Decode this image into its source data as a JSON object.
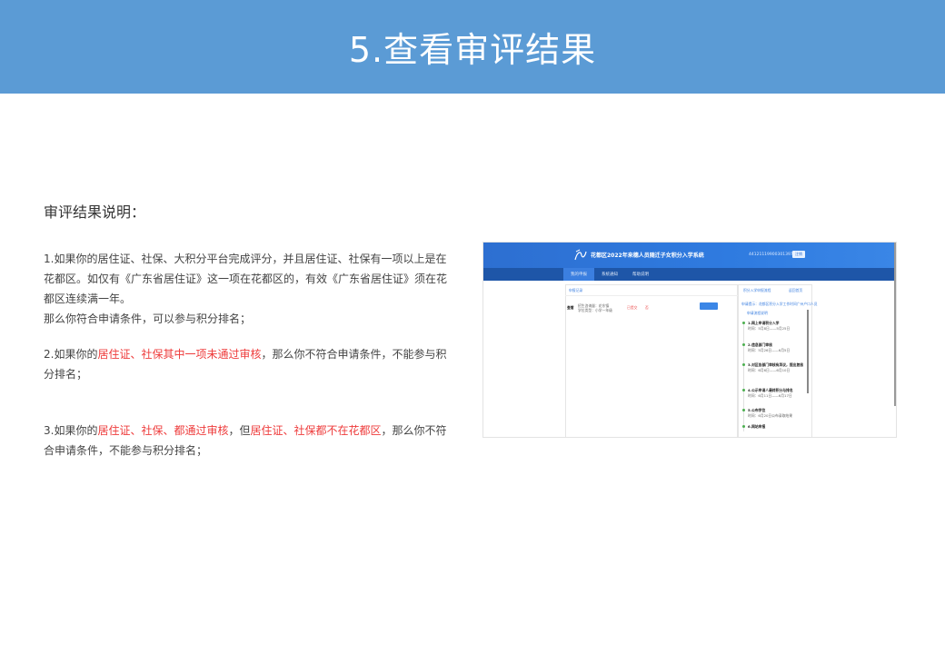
{
  "banner": {
    "title": "5.查看审评结果"
  },
  "section": {
    "title": "审评结果说明："
  },
  "paragraphs": {
    "p1": "1.如果你的居住证、社保、大积分平台完成评分，并且居住证、社保有一项以上是在花都区。如仅有《广东省居住证》这一项在花都区的，有效《广东省居住证》须在花都区连续满一年。",
    "p1_line2": "那么你符合申请条件，可以参与积分排名；",
    "p2_a": "2.如果你的",
    "p2_red": "居住证、社保其中一项未通过审核",
    "p2_b": "，那么你不符合申请条件，不能参与积分排名；",
    "p3_a": "3.如果你的",
    "p3_red1": "居住证、社保、都通过审核",
    "p3_b": "，但",
    "p3_red2": "居住证、社保都不在花都区",
    "p3_c": "，那么你不符合申请条件，不能参与积分排名；"
  },
  "screenshot": {
    "title": "花都区2022年来穗人员随迁子女积分入学系统",
    "user": "441211199003013977",
    "logout": "注销",
    "nav": [
      "我的申报",
      "系统通知",
      "帮助说明"
    ],
    "left_header": "申报记录",
    "row_name": "查看",
    "row_info1": "招生咨询量：花东镇",
    "row_info2": "学位类型：小学一年级",
    "row_status1": "已提交",
    "row_status2": "否",
    "right_header1": "积分入学申报流程",
    "right_header2": "返回首页",
    "right_note": "申请提示：花都区积分入学工作时间广州户口人员",
    "right_link": "申请流程说明",
    "steps": [
      {
        "title": "1.网上申请积分入学",
        "desc": "时间：5月8日——5月25日"
      },
      {
        "title": "2.信息部门审核",
        "desc": "时间：5月26日——6月5日"
      },
      {
        "title": "3.对区各部门审核有异议，提出复核",
        "desc": "时间：6月6日——6月10日"
      },
      {
        "title": "4.公示申请人最终积分与排名",
        "desc": "时间：6月11日——6月17日"
      },
      {
        "title": "5.公布学位",
        "desc": "时间：6月20日公布录取结果"
      },
      {
        "title": "6.网站申报",
        "desc": ""
      }
    ]
  },
  "colors": {
    "banner": "#5b9bd5",
    "accent_red": "#ee3b3b",
    "header_blue": "#2f7be0"
  }
}
